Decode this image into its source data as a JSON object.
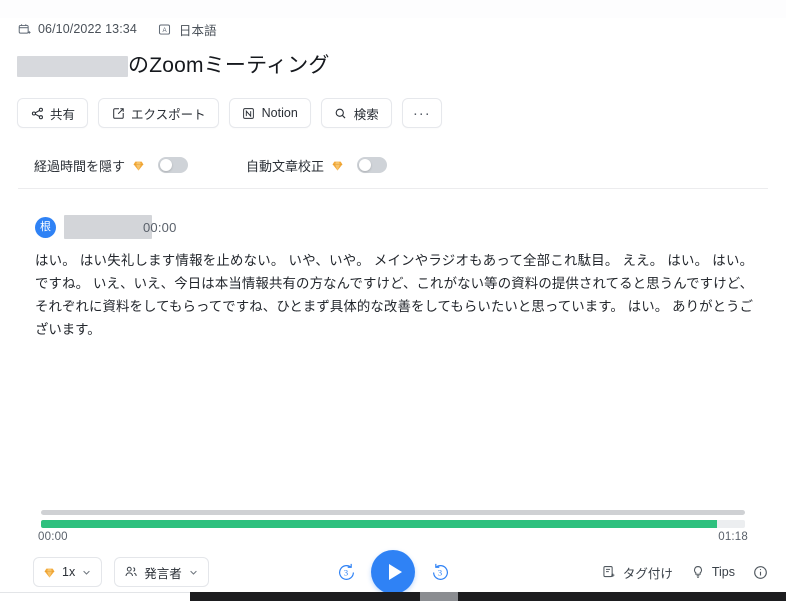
{
  "meta": {
    "date_icon": "calendar-add-icon",
    "datetime": "06/10/2022 13:34",
    "language_icon": "language-a-icon",
    "language": "日本語"
  },
  "title": {
    "redacted_name": "",
    "suffix": "のZoomミーティング"
  },
  "toolbar": {
    "buttons": [
      {
        "label": "共有",
        "icon": "share-icon"
      },
      {
        "label": "エクスポート",
        "icon": "external-link-icon"
      },
      {
        "label": "Notion",
        "icon": "notion-icon"
      },
      {
        "label": "検索",
        "icon": "search-icon"
      },
      {
        "label": "···",
        "icon": "more-horizontal-icon"
      }
    ]
  },
  "options": [
    {
      "label": "経過時間を隠す",
      "badge": "premium-diamond-icon",
      "state": "off"
    },
    {
      "label": "自動文章校正",
      "badge": "premium-diamond-icon",
      "state": "off"
    }
  ],
  "transcript": {
    "speaker": {
      "avatar_initial": "根",
      "name_redacted": "",
      "timestamp": "00:00"
    },
    "text": "はい。 はい失礼します情報を止めない。 いや、いや。 メインやラジオもあって全部これ駄目。 ええ。 はい。 はい。 ですね。 いえ、いえ、今日は本当情報共有の方なんですけど、これがない等の資料の提供されてると思うんですけど、それぞれに資料をしてもらってですね、ひとまず具体的な改善をしてもらいたいと思っています。 はい。 ありがとうございます。"
  },
  "player": {
    "current_time": "00:00",
    "total_time": "01:18",
    "progress_percent": 0,
    "loaded_percent": 96,
    "speed": {
      "label": "1x",
      "badge": "premium-diamond-icon",
      "icon": "chevron-down-icon"
    },
    "speaker_filter": {
      "label": "発言者",
      "icon": "people-icon",
      "chevron": "chevron-down-icon"
    },
    "rewind": {
      "label": "3",
      "icon": "rewind-3-icon"
    },
    "forward": {
      "label": "3",
      "icon": "forward-3-icon"
    },
    "play": {
      "icon": "play-icon"
    },
    "right_actions": [
      {
        "label": "タグ付け",
        "icon": "tag-icon"
      },
      {
        "label": "Tips",
        "icon": "lightbulb-icon"
      },
      {
        "label": "",
        "icon": "info-circle-icon"
      }
    ]
  },
  "colors": {
    "accent_blue": "#2f82f5",
    "progress_green": "#2ec07e",
    "premium_gold": "#f0a02a",
    "track_gray": "#cfd1d4"
  }
}
